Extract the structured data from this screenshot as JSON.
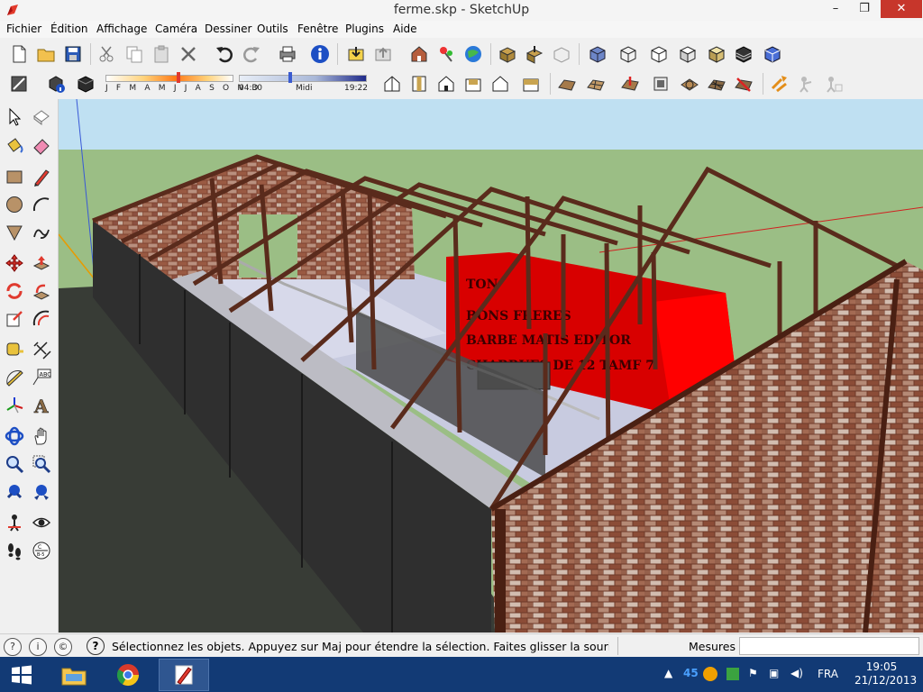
{
  "window": {
    "title": "ferme.skp - SketchUp",
    "minimize": "–",
    "maximize": "❐",
    "close": "✕"
  },
  "menu": [
    {
      "label": "Fichier"
    },
    {
      "label": "Édition"
    },
    {
      "label": "Affichage"
    },
    {
      "label": "Caméra"
    },
    {
      "label": "Dessiner"
    },
    {
      "label": "Outils"
    },
    {
      "label": "Fenêtre"
    },
    {
      "label": "Plugins"
    },
    {
      "label": "Aide"
    }
  ],
  "shadows": {
    "months": "J F M A M J J A S O N D",
    "time_start": "04:30",
    "time_mid": "Midi",
    "time_end": "19:22"
  },
  "statusbar": {
    "hint": "Sélectionnez les objets. Appuyez sur Maj pour étendre la sélection. Faites glisser la souris pou",
    "measures_label": "Mesures",
    "measures_value": ""
  },
  "scene": {
    "trailer_text": [
      "TON",
      "BONS FRERES",
      "BARBE MATIS EDITOR",
      "CHARRUES DE 12 TAMF 7"
    ]
  },
  "taskbar": {
    "language": "FRA",
    "badge": "45",
    "time": "19:05",
    "date": "21/12/2013"
  },
  "colors": {
    "sky": "#bfe0f2",
    "ground": "#9bbe85",
    "brick": "#8a4a35",
    "trailer": "#d80000",
    "taskbar": "#123a75"
  }
}
